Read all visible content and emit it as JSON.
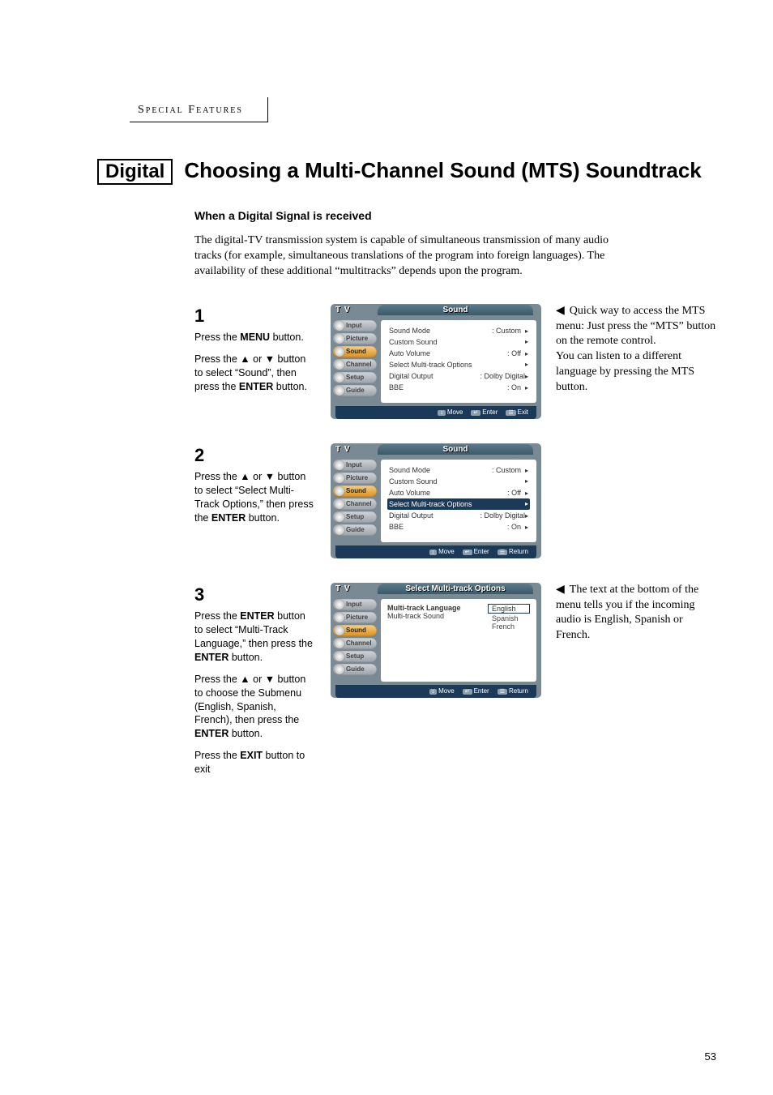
{
  "section_header": "Special Features",
  "digital_tag": "Digital",
  "title": "Choosing a Multi-Channel Sound (MTS) Soundtrack",
  "subheading": "When a Digital Signal is received",
  "intro": "The digital-TV transmission system is capable of simultaneous transmission of many audio tracks (for example, simultaneous translations of the program into foreign languages). The availability of these additional “multitracks” depends upon the program.",
  "steps": [
    {
      "num": "1",
      "p1_a": "Press the ",
      "p1_b": "MENU",
      "p1_c": " button.",
      "p2_a": "Press the ▲ or ▼ button to select “Sound”, then press the ",
      "p2_b": "ENTER",
      "p2_c": " button."
    },
    {
      "num": "2",
      "p1_a": "Press the ▲ or ▼ button to select “Select Multi-Track Options,” then press the ",
      "p1_b": "ENTER",
      "p1_c": " button."
    },
    {
      "num": "3",
      "p1_a": "Press the ",
      "p1_b": "ENTER",
      "p1_c": " button to select “Multi-Track Language,” then press the ",
      "p1_d": "ENTER",
      "p1_e": " button.",
      "p2_a": "Press the ▲ or ▼ button to choose the Submenu (English, Spanish, French), then press the ",
      "p2_b": "ENTER",
      "p2_c": " button.",
      "p3_a": "Press the ",
      "p3_b": "EXIT",
      "p3_c": " button to exit"
    }
  ],
  "notes": {
    "n1": "Quick way to access the MTS menu: Just press the “MTS” button on the remote control.\nYou can listen to a different language by pressing the MTS button.",
    "n3": "The text at the bottom of the menu tells you if the incoming audio is English, Spanish or French."
  },
  "osd": {
    "tv": "T V",
    "sound_title": "Sound",
    "mto_title": "Select Multi-track Options",
    "side": [
      "Input",
      "Picture",
      "Sound",
      "Channel",
      "Setup",
      "Guide"
    ],
    "menu1": [
      {
        "l": "Sound Mode",
        "v": ": Custom",
        "a": "▸"
      },
      {
        "l": "Custom Sound",
        "v": "",
        "a": "▸"
      },
      {
        "l": "Auto Volume",
        "v": ": Off",
        "a": "▸"
      },
      {
        "l": "Select Multi-track Options",
        "v": "",
        "a": "▸"
      },
      {
        "l": "Digital Output",
        "v": ": Dolby Digital",
        "a": "▸"
      },
      {
        "l": "BBE",
        "v": ": On",
        "a": "▸"
      }
    ],
    "menu3_left": [
      "Multi-track Language",
      "Multi-track Sound"
    ],
    "menu3_right": [
      "English",
      "Spanish",
      "French"
    ],
    "footer": {
      "move": "Move",
      "enter": "Enter",
      "exit": "Exit",
      "return": "Return",
      "k_move": "↕",
      "k_enter": "↵",
      "k_box": "☰"
    }
  },
  "page_num": "53"
}
